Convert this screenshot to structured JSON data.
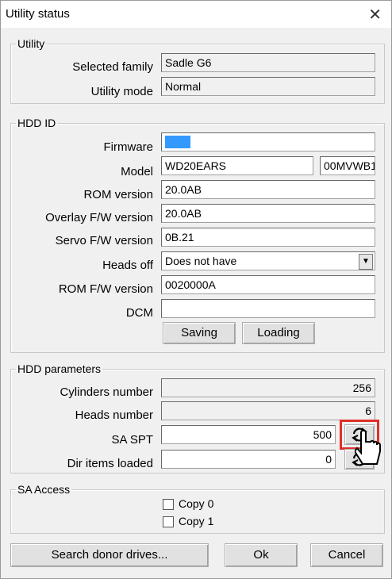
{
  "window": {
    "title": "Utility status",
    "close_glyph": "✕"
  },
  "utility": {
    "legend": "Utility",
    "selected_family_label": "Selected family",
    "selected_family_value": "Sadle G6",
    "utility_mode_label": "Utility mode",
    "utility_mode_value": "Normal"
  },
  "hdd_id": {
    "legend": "HDD ID",
    "firmware_label": "Firmware",
    "model_label": "Model",
    "model_value": "WD20EARS",
    "model_value2": "00MVWB1",
    "rom_version_label": "ROM version",
    "rom_version_value": "20.0AB",
    "overlay_label": "Overlay F/W version",
    "overlay_value": "20.0AB",
    "servo_label": "Servo F/W version",
    "servo_value": "0B.21",
    "heads_off_label": "Heads off",
    "heads_off_value": "Does not have",
    "rom_fw_label": "ROM F/W version",
    "rom_fw_value": "0020000A",
    "dcm_label": "DCM",
    "dcm_value": "",
    "saving_button": "Saving",
    "loading_button": "Loading"
  },
  "hdd_params": {
    "legend": "HDD parameters",
    "cylinders_label": "Cylinders number",
    "cylinders_value": "256",
    "heads_label": "Heads number",
    "heads_value": "6",
    "sa_spt_label": "SA SPT",
    "sa_spt_value": "500",
    "dir_items_label": "Dir items loaded",
    "dir_items_value": "0",
    "refresh_icon": "refresh-icon"
  },
  "sa_access": {
    "legend": "SA Access",
    "copy0_label": "Copy 0",
    "copy1_label": "Copy 1"
  },
  "footer": {
    "search_button": "Search donor drives...",
    "ok_button": "Ok",
    "cancel_button": "Cancel"
  },
  "colors": {
    "highlight": "#e0302a",
    "firmware_swatch": "#3399ff"
  }
}
